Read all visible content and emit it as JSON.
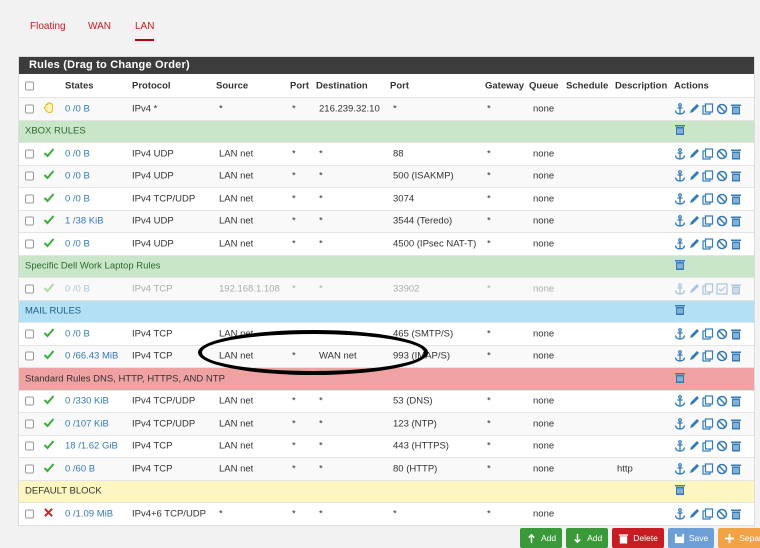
{
  "tabs": [
    {
      "label": "Floating"
    },
    {
      "label": "WAN"
    },
    {
      "label": "LAN",
      "active": true
    }
  ],
  "panel_title": "Rules (Drag to Change Order)",
  "columns": [
    "States",
    "Protocol",
    "Source",
    "Port",
    "Destination",
    "Port",
    "Gateway",
    "Queue",
    "Schedule",
    "Description",
    "Actions"
  ],
  "colors": {
    "accent": "#c71c22",
    "link": "#337ab7",
    "pass": "#3cad3c",
    "block": "#d01d1d",
    "sep_green": "#c9e6c9",
    "sep_blue": "#b3e0f5",
    "sep_red": "#f0a1a1",
    "sep_yellow": "#fdf6c1"
  },
  "rows": [
    {
      "type": "rule",
      "icon": "hand-icon",
      "states": "0 /0 B",
      "protocol": "IPv4 *",
      "source": "*",
      "sport": "*",
      "dest": "216.239.32.10",
      "dport": "*",
      "gateway": "*",
      "queue": "none",
      "schedule": "",
      "description": ""
    },
    {
      "type": "sep",
      "label": "XBOX RULES",
      "color": "green"
    },
    {
      "type": "rule",
      "icon": "check-icon",
      "states": "0 /0 B",
      "protocol": "IPv4 UDP",
      "source": "LAN net",
      "sport": "*",
      "dest": "*",
      "dport": "88",
      "gateway": "*",
      "queue": "none",
      "schedule": "",
      "description": ""
    },
    {
      "type": "rule",
      "icon": "check-icon",
      "states": "0 /0 B",
      "protocol": "IPv4 UDP",
      "source": "LAN net",
      "sport": "*",
      "dest": "*",
      "dport": "500 (ISAKMP)",
      "gateway": "*",
      "queue": "none",
      "schedule": "",
      "description": ""
    },
    {
      "type": "rule",
      "icon": "check-icon",
      "states": "0 /0 B",
      "protocol": "IPv4 TCP/UDP",
      "source": "LAN net",
      "sport": "*",
      "dest": "*",
      "dport": "3074",
      "gateway": "*",
      "queue": "none",
      "schedule": "",
      "description": ""
    },
    {
      "type": "rule",
      "icon": "check-icon",
      "states": "1 /38 KiB",
      "protocol": "IPv4 UDP",
      "source": "LAN net",
      "sport": "*",
      "dest": "*",
      "dport": "3544 (Teredo)",
      "gateway": "*",
      "queue": "none",
      "schedule": "",
      "description": ""
    },
    {
      "type": "rule",
      "icon": "check-icon",
      "states": "0 /0 B",
      "protocol": "IPv4 UDP",
      "source": "LAN net",
      "sport": "*",
      "dest": "*",
      "dport": "4500 (IPsec NAT-T)",
      "gateway": "*",
      "queue": "none",
      "schedule": "",
      "description": ""
    },
    {
      "type": "sep",
      "label": "Specific Dell Work Laptop Rules",
      "color": "green"
    },
    {
      "type": "rule",
      "icon": "check-icon",
      "disabled": true,
      "states": "0 /0 B",
      "protocol": "IPv4 TCP",
      "source": "192.168.1.108",
      "sport": "*",
      "dest": "*",
      "dport": "33902",
      "gateway": "*",
      "queue": "none",
      "schedule": "",
      "description": ""
    },
    {
      "type": "sep",
      "label": "MAIL RULES",
      "color": "blue"
    },
    {
      "type": "rule",
      "icon": "check-icon",
      "states": "0 /0 B",
      "protocol": "IPv4 TCP",
      "source": "LAN net",
      "sport": "*",
      "dest": "*",
      "dport": "465 (SMTP/S)",
      "gateway": "*",
      "queue": "none",
      "schedule": "",
      "description": ""
    },
    {
      "type": "rule",
      "icon": "check-icon",
      "states": "0 /66.43 MiB",
      "protocol": "IPv4 TCP",
      "source": "LAN net",
      "sport": "*",
      "dest": "WAN net",
      "dport": "993 (IMAP/S)",
      "gateway": "*",
      "queue": "none",
      "schedule": "",
      "description": ""
    },
    {
      "type": "sep",
      "label": "Standard Rules DNS, HTTP, HTTPS, AND NTP",
      "color": "red"
    },
    {
      "type": "rule",
      "icon": "check-icon",
      "states": "0 /330 KiB",
      "protocol": "IPv4 TCP/UDP",
      "source": "LAN net",
      "sport": "*",
      "dest": "*",
      "dport": "53 (DNS)",
      "gateway": "*",
      "queue": "none",
      "schedule": "",
      "description": ""
    },
    {
      "type": "rule",
      "icon": "check-icon",
      "states": "0 /107 KiB",
      "protocol": "IPv4 TCP/UDP",
      "source": "LAN net",
      "sport": "*",
      "dest": "*",
      "dport": "123 (NTP)",
      "gateway": "*",
      "queue": "none",
      "schedule": "",
      "description": ""
    },
    {
      "type": "rule",
      "icon": "check-icon",
      "states": "18 /1.62 GiB",
      "protocol": "IPv4 TCP",
      "source": "LAN net",
      "sport": "*",
      "dest": "*",
      "dport": "443 (HTTPS)",
      "gateway": "*",
      "queue": "none",
      "schedule": "",
      "description": ""
    },
    {
      "type": "rule",
      "icon": "check-icon",
      "states": "0 /60 B",
      "protocol": "IPv4 TCP",
      "source": "LAN net",
      "sport": "*",
      "dest": "*",
      "dport": "80 (HTTP)",
      "gateway": "*",
      "queue": "none",
      "schedule": "",
      "description": "http"
    },
    {
      "type": "sep",
      "label": "DEFAULT BLOCK",
      "color": "yellow"
    },
    {
      "type": "rule",
      "icon": "x-icon",
      "states": "0 /1.09 MiB",
      "protocol": "IPv4+6 TCP/UDP",
      "source": "*",
      "sport": "*",
      "dest": "*",
      "dport": "*",
      "gateway": "*",
      "queue": "none",
      "schedule": "",
      "description": ""
    }
  ],
  "buttons": [
    {
      "label": "Add",
      "icon": "arrow-up-icon",
      "color": "#3a9a3a"
    },
    {
      "label": "Add",
      "icon": "arrow-down-icon",
      "color": "#3a9a3a"
    },
    {
      "label": "Delete",
      "icon": "trash-icon",
      "color": "#c71c22"
    },
    {
      "label": "Save",
      "icon": "save-icon",
      "color": "#6d9fd6"
    },
    {
      "label": "Separator",
      "icon": "plus-icon",
      "color": "#f0a244"
    }
  ]
}
